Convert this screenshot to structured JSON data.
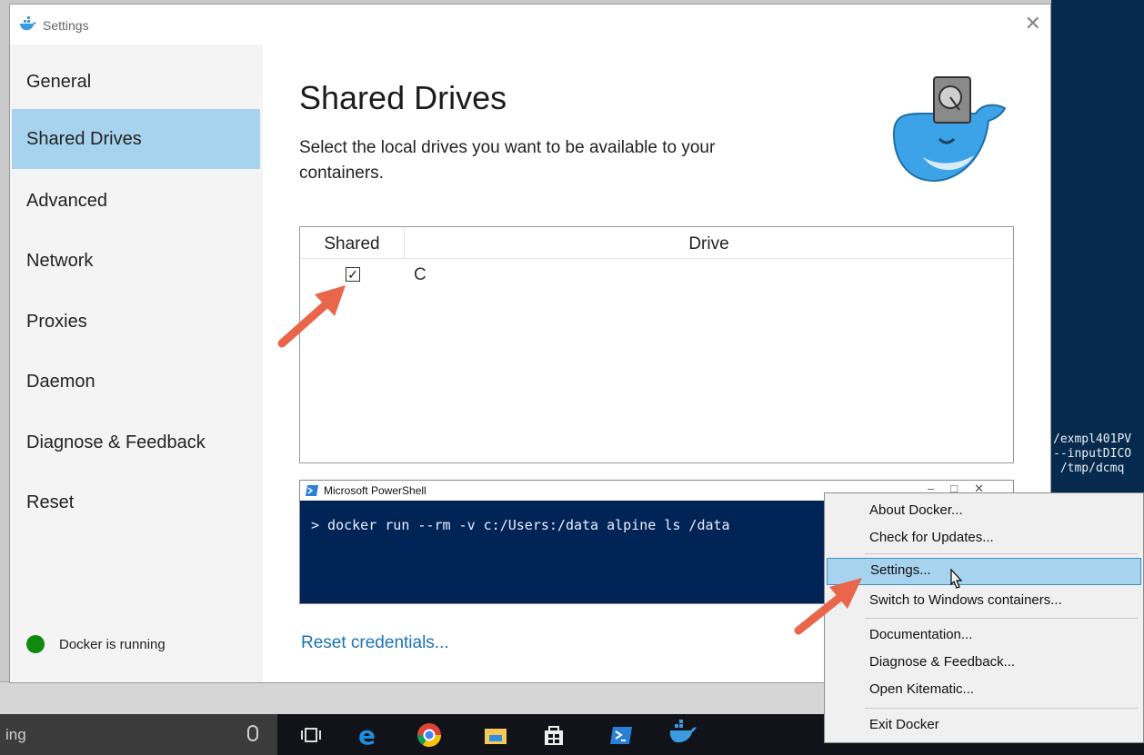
{
  "window": {
    "title": "Settings",
    "close_symbol": "✕"
  },
  "sidebar": {
    "items": [
      {
        "label": "General"
      },
      {
        "label": "Shared Drives"
      },
      {
        "label": "Advanced"
      },
      {
        "label": "Network"
      },
      {
        "label": "Proxies"
      },
      {
        "label": "Daemon"
      },
      {
        "label": "Diagnose & Feedback"
      },
      {
        "label": "Reset"
      }
    ],
    "active": "Shared Drives",
    "status": "Docker is running"
  },
  "main": {
    "title": "Shared Drives",
    "description": "Select the local drives you want to be available to your containers.",
    "table": {
      "headers": {
        "shared": "Shared",
        "drive": "Drive"
      },
      "rows": [
        {
          "checked": true,
          "check_mark": "✓",
          "drive": "C"
        }
      ]
    },
    "reset_link": "Reset credentials..."
  },
  "powershell": {
    "title": "Microsoft PowerShell",
    "controls": "–□✕",
    "command": "> docker run --rm -v c:/Users:/data alpine ls /data"
  },
  "console_bg": {
    "lines": "/exmpl401PV\n--inputDICO\n /tmp/dcmq"
  },
  "context_menu": {
    "items": [
      {
        "label": "About Docker..."
      },
      {
        "label": "Check for Updates..."
      },
      {
        "label": "Settings..."
      },
      {
        "label": "Switch to Windows containers..."
      },
      {
        "label": "Documentation..."
      },
      {
        "label": "Diagnose & Feedback..."
      },
      {
        "label": "Open Kitematic..."
      },
      {
        "label": "Exit Docker"
      }
    ],
    "highlighted": "Settings..."
  },
  "taskbar": {
    "search_text": "ing"
  },
  "colors": {
    "accent": "#a7d3ee",
    "link": "#1a73b8",
    "status_green": "#0f8a0f",
    "powershell_bg": "#012456",
    "arrow": "#e9664a"
  }
}
